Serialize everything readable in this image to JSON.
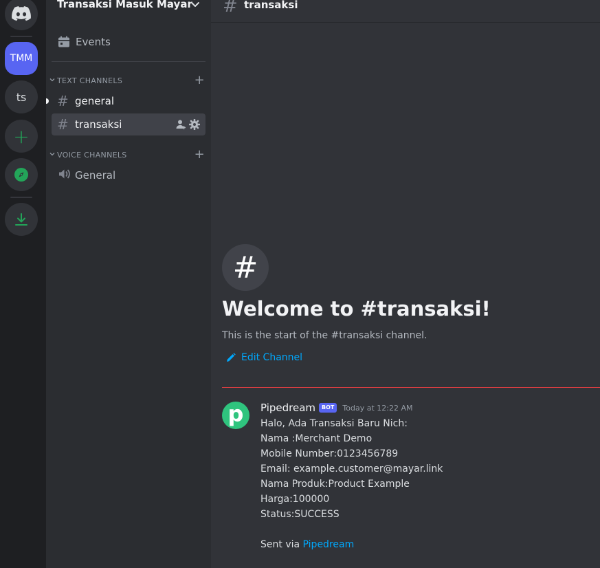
{
  "servers": {
    "home_icon": "discord-logo-icon",
    "items": [
      {
        "label": "TMM",
        "active": true
      },
      {
        "label": "ts",
        "active": false
      }
    ],
    "add_icon": "+",
    "explore_icon": "compass-icon",
    "download_icon": "download-icon"
  },
  "guild": {
    "name": "Transaksi Masuk Mayar",
    "events_label": "Events",
    "categories": {
      "text": "TEXT CHANNELS",
      "voice": "VOICE CHANNELS"
    },
    "text_channels": [
      {
        "name": "general",
        "unread": true
      },
      {
        "name": "transaksi",
        "selected": true
      }
    ],
    "voice_channels": [
      {
        "name": "General"
      }
    ]
  },
  "channel": {
    "hash": "#",
    "name": "transaksi",
    "welcome_title": "Welcome to #transaksi!",
    "welcome_subtitle": "This is the start of the #transaksi channel.",
    "edit_label": "Edit Channel"
  },
  "message": {
    "avatar_letter": "p",
    "author": "Pipedream",
    "bot_tag": "BOT",
    "timestamp": "Today at 12:22 AM",
    "lines": [
      "Halo, Ada Transaksi Baru Nich:",
      "Nama :Merchant Demo",
      "Mobile Number:0123456789",
      "Email: example.customer@mayar.link",
      "Nama Produk:Product Example",
      "Harga:100000",
      "Status:SUCCESS"
    ],
    "footer_prefix": "Sent via ",
    "footer_link": "Pipedream"
  },
  "colors": {
    "accent": "#5865f2",
    "link": "#00a8fc",
    "green": "#23a559",
    "new_divider": "#f23f43",
    "avatar_bg": "#2fc47e"
  }
}
